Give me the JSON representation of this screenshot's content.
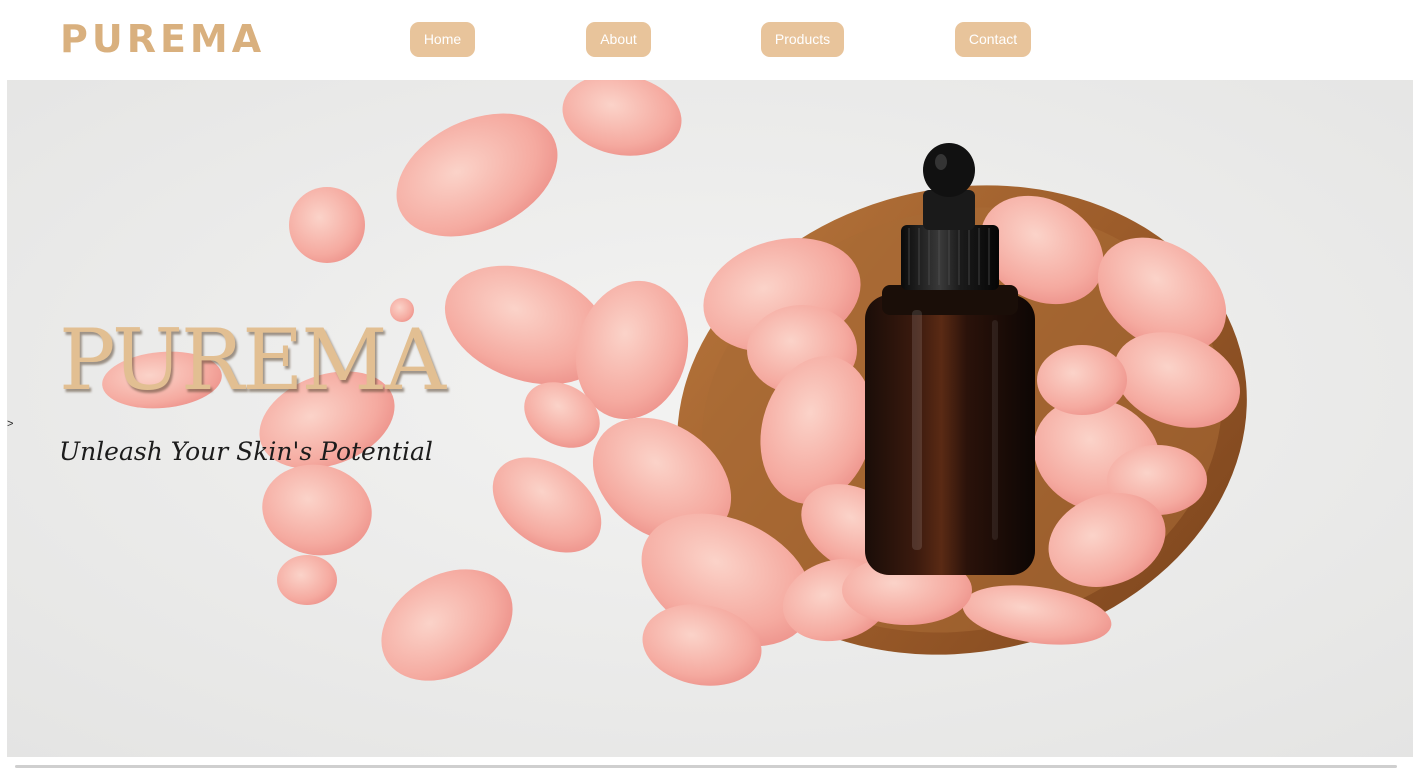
{
  "header": {
    "logo_text": "PUREMA",
    "nav": [
      {
        "label": "Home"
      },
      {
        "label": "About"
      },
      {
        "label": "Products"
      },
      {
        "label": "Contact"
      }
    ]
  },
  "hero": {
    "title": "PUREMA",
    "tagline": "Unleash Your Skin's Potential",
    "stray_text": ">"
  },
  "colors": {
    "accent": "#e8c49b",
    "brand_gold": "#d9b07e",
    "hero_title": "#e2bf92",
    "petal": "#f4a9a0",
    "wood": "#a0622f"
  }
}
